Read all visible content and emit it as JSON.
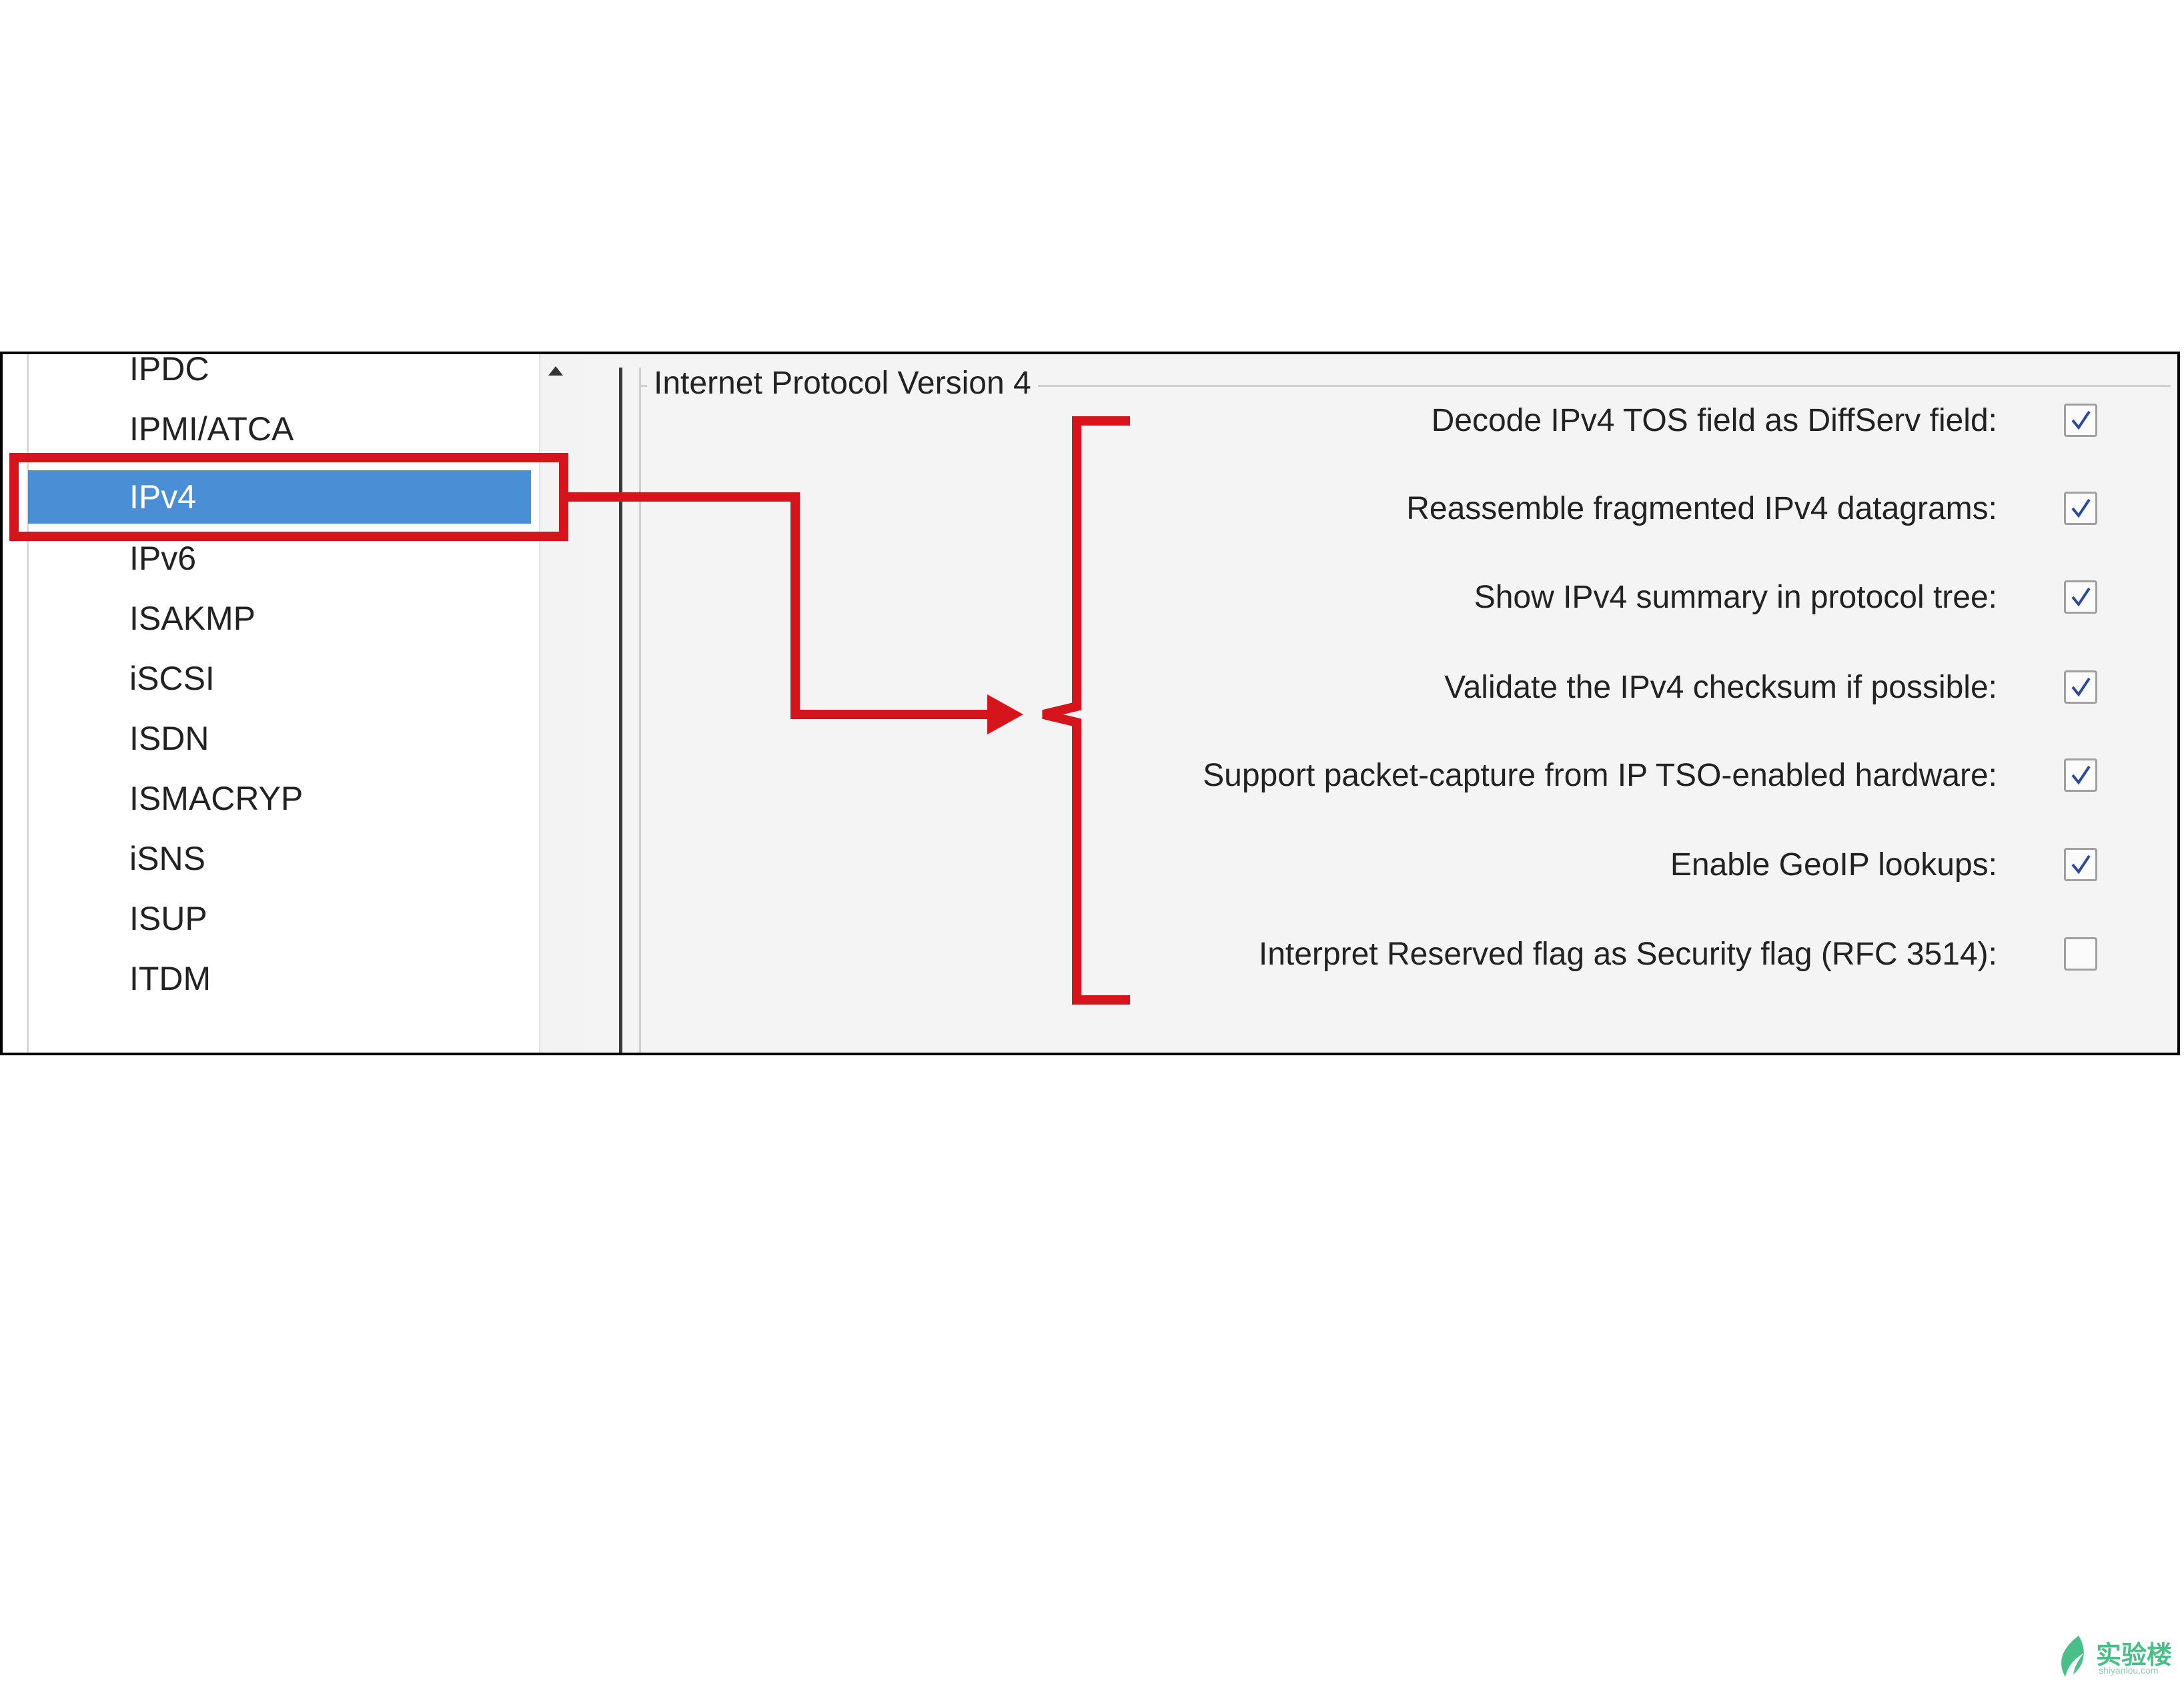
{
  "protocol_list": {
    "items": [
      {
        "label": "IPDC",
        "selected": false
      },
      {
        "label": "IPMI/ATCA",
        "selected": false
      },
      {
        "label": "IPv4",
        "selected": true
      },
      {
        "label": "IPv6",
        "selected": false
      },
      {
        "label": "ISAKMP",
        "selected": false
      },
      {
        "label": "iSCSI",
        "selected": false
      },
      {
        "label": "ISDN",
        "selected": false
      },
      {
        "label": "ISMACRYP",
        "selected": false
      },
      {
        "label": "iSNS",
        "selected": false
      },
      {
        "label": "ISUP",
        "selected": false
      },
      {
        "label": "ITDM",
        "selected": false
      }
    ]
  },
  "group": {
    "title": "Internet Protocol Version 4"
  },
  "preferences": [
    {
      "label": "Decode IPv4 TOS field as DiffServ field:",
      "checked": true
    },
    {
      "label": "Reassemble fragmented IPv4 datagrams:",
      "checked": true
    },
    {
      "label": "Show IPv4 summary in protocol tree:",
      "checked": true
    },
    {
      "label": "Validate the IPv4 checksum if possible:",
      "checked": true
    },
    {
      "label": "Support packet-capture from IP TSO-enabled hardware:",
      "checked": true
    },
    {
      "label": "Enable GeoIP lookups:",
      "checked": true
    },
    {
      "label": "Interpret Reserved flag as Security flag (RFC 3514):",
      "checked": false
    }
  ],
  "colors": {
    "highlight_red": "#d6141c",
    "selection_blue": "#4a8fd6",
    "watermark_green": "#4bbf8a"
  },
  "watermark": {
    "title": "实验楼",
    "subtitle": "shiyanlou.com"
  }
}
